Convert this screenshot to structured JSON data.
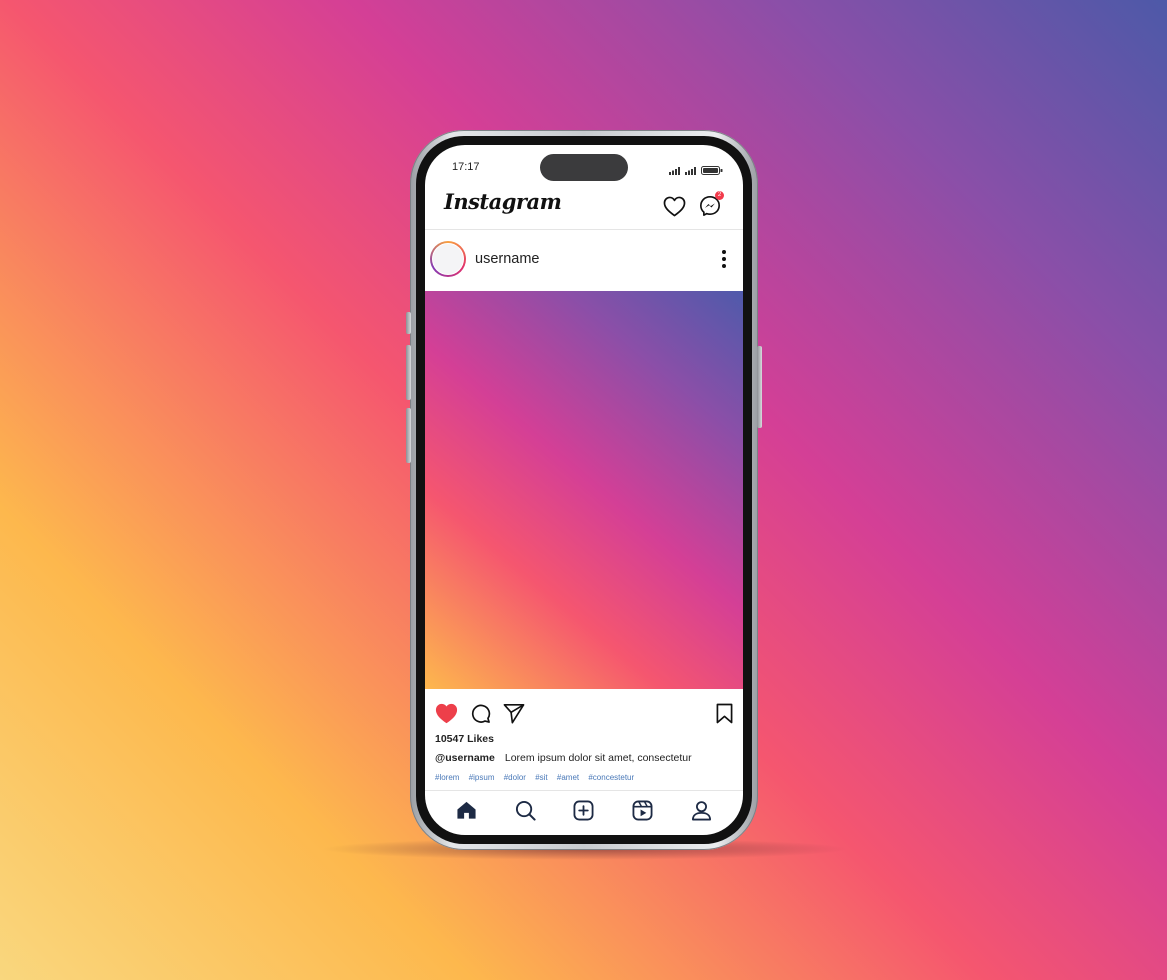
{
  "status_bar": {
    "time": "17:17",
    "icons": [
      "signal-icon",
      "wifi-signal-icon",
      "battery-icon"
    ]
  },
  "header": {
    "logo_text": "Instagram",
    "icons": [
      "heart-icon",
      "messenger-icon"
    ],
    "messenger_badge": "2"
  },
  "post": {
    "username": "username",
    "more_icon": "more-vertical-icon",
    "liked": true,
    "action_icons": [
      "heart-filled-icon",
      "comment-icon",
      "send-icon",
      "bookmark-icon"
    ],
    "likes_text": "10547 Likes",
    "caption_user": "@username",
    "caption_text": "Lorem ipsum dolor sit amet, consectetur",
    "hashtags": [
      "#lorem",
      "#ipsum",
      "#dolor",
      "#sit",
      "#amet",
      "#concestetur"
    ]
  },
  "bottom_nav": {
    "items": [
      "home-icon",
      "search-icon",
      "add-post-icon",
      "reels-icon",
      "profile-icon"
    ]
  },
  "colors": {
    "like_red": "#ed3f4a",
    "hashtag_blue": "#4a79b8",
    "nav_dark": "#1d2a44"
  }
}
